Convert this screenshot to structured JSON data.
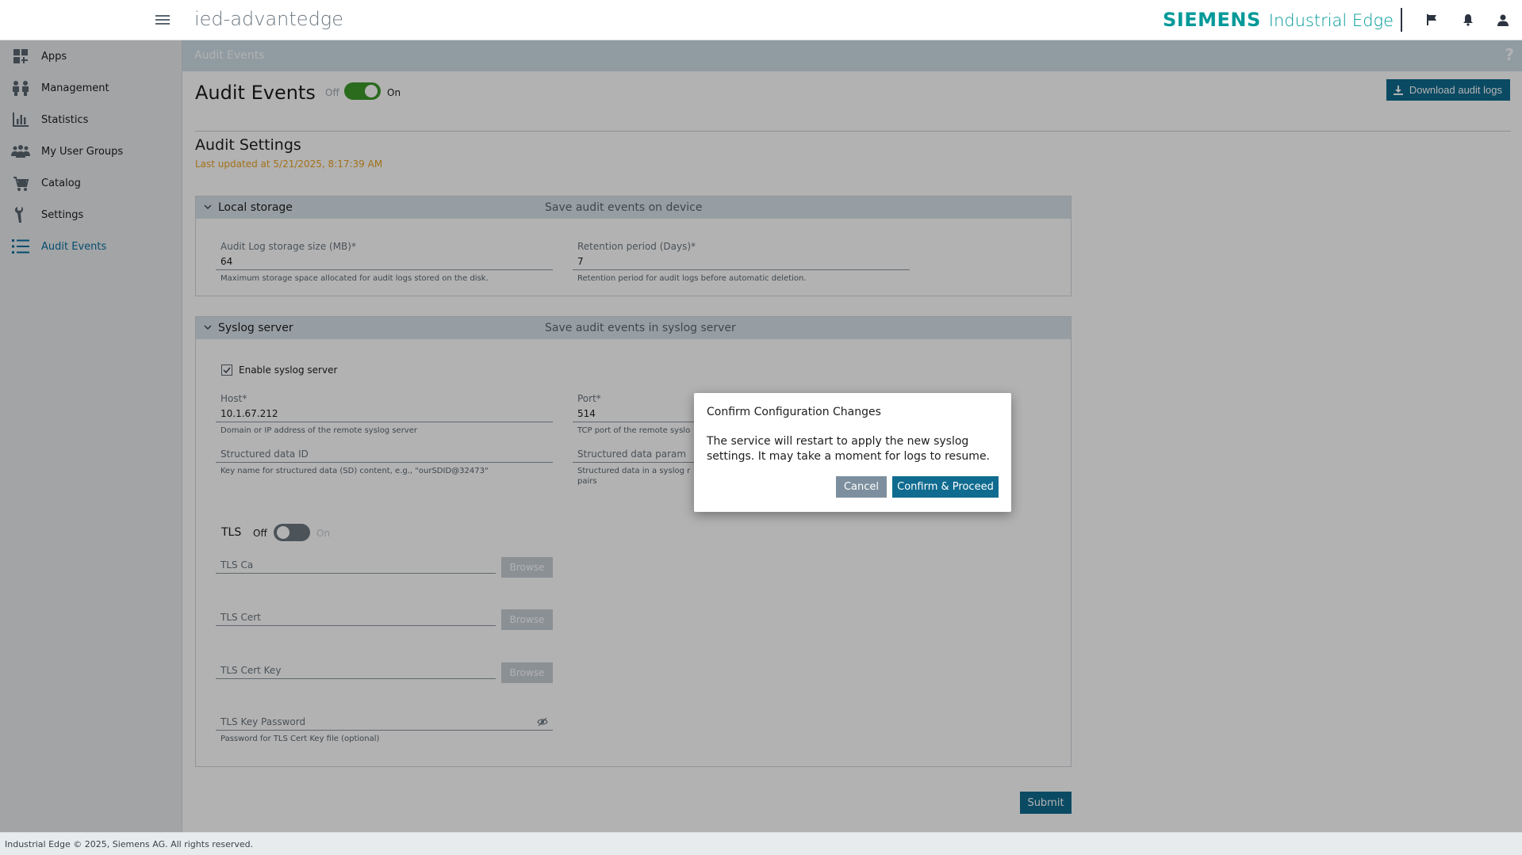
{
  "header": {
    "app_title": "ied-advantedge",
    "brand_name": "SIEMENS",
    "brand_product": "Industrial Edge",
    "icons": [
      "menu-icon",
      "flag-icon",
      "bell-icon",
      "user-icon"
    ]
  },
  "sidebar": {
    "items": [
      {
        "label": "Apps",
        "icon": "apps-icon"
      },
      {
        "label": "Management",
        "icon": "management-icon"
      },
      {
        "label": "Statistics",
        "icon": "statistics-icon"
      },
      {
        "label": "My User Groups",
        "icon": "user-groups-icon"
      },
      {
        "label": "Catalog",
        "icon": "catalog-icon"
      },
      {
        "label": "Settings",
        "icon": "settings-icon"
      },
      {
        "label": "Audit Events",
        "icon": "list-icon",
        "active": true
      }
    ]
  },
  "subheader": {
    "title": "Audit Events",
    "help": "?"
  },
  "page": {
    "title": "Audit Events",
    "toggle_off": "Off",
    "toggle_on": "On",
    "toggle_state": true,
    "download_label": "Download audit logs",
    "section_title": "Audit Settings",
    "last_updated": "Last updated at 5/21/2025, 8:17:39 AM",
    "submit_label": "Submit"
  },
  "local_storage": {
    "title": "Local storage",
    "subtitle": "Save audit events on device",
    "size_label": "Audit Log storage size (MB)*",
    "size_value": "64",
    "size_help": "Maximum storage space allocated for audit logs stored on the disk.",
    "retention_label": "Retention period (Days)*",
    "retention_value": "7",
    "retention_help": "Retention period for audit logs before automatic deletion."
  },
  "syslog": {
    "title": "Syslog server",
    "subtitle": "Save audit events in syslog server",
    "enable_label": "Enable syslog server",
    "enabled": true,
    "host_label": "Host*",
    "host_value": "10.1.67.212",
    "host_help": "Domain or IP address of the remote syslog server",
    "port_label": "Port*",
    "port_value": "514",
    "port_help": "TCP port of the remote syslo",
    "sdid_label": "Structured data ID",
    "sdid_help": "Key name for structured data (SD) content, e.g., \"ourSDID@32473\"",
    "sdparam_label": "Structured data param",
    "sdparam_help": "Structured data in a syslog r",
    "sdparam_help2": "pairs",
    "tls_label": "TLS",
    "tls_off": "Off",
    "tls_on": "On",
    "tls_state": false,
    "tls_ca": "TLS Ca",
    "tls_cert": "TLS Cert",
    "tls_cert_key": "TLS Cert Key",
    "tls_key_password": "TLS Key Password",
    "tls_key_password_help": "Password for TLS Cert Key file (optional)",
    "browse_label": "Browse"
  },
  "dialog": {
    "title": "Confirm Configuration Changes",
    "text": "The service will restart to apply the new syslog settings. It may take a moment for logs to resume.",
    "cancel_label": "Cancel",
    "confirm_label": "Confirm & Proceed"
  },
  "footer": {
    "text": "Industrial Edge © 2025, Siemens AG. All rights reserved."
  },
  "colors": {
    "accent": "#0f6b8f",
    "brand": "#009999",
    "toggle_on": "#3d9a2b",
    "warning_text": "#e8a326",
    "active_nav": "#0b6f9e"
  }
}
